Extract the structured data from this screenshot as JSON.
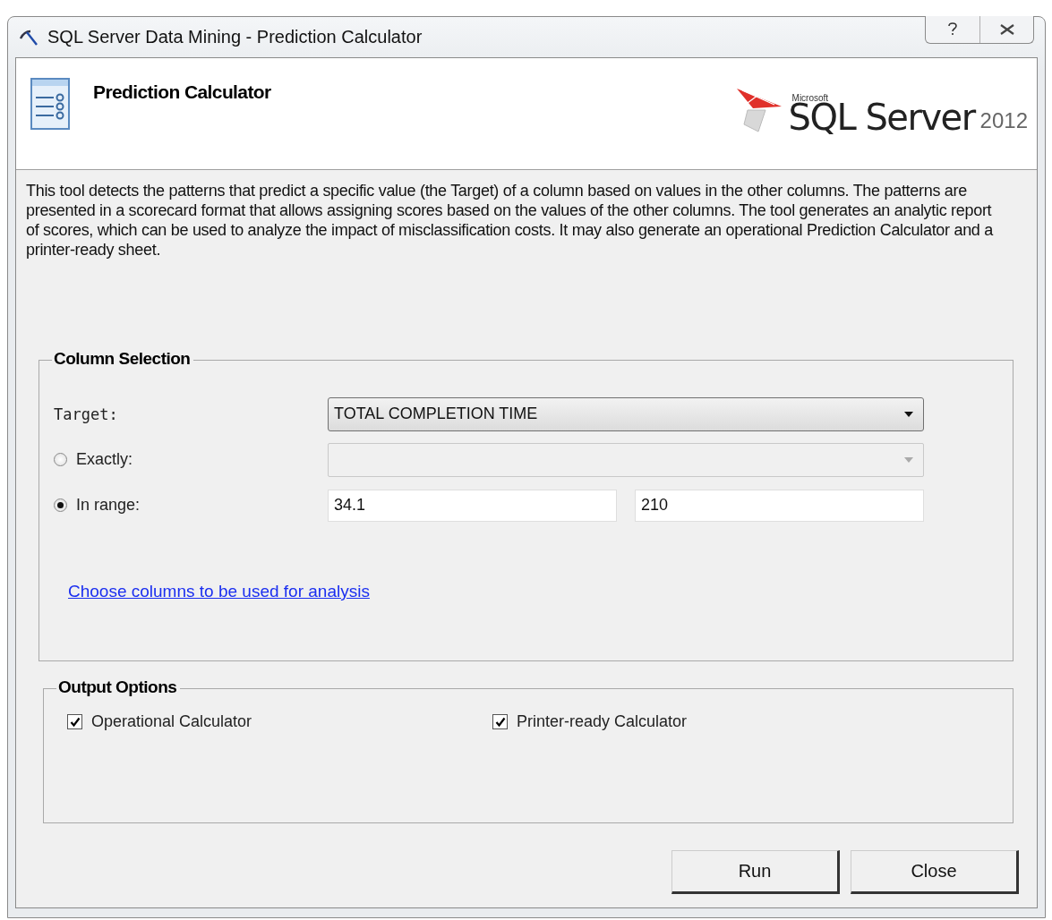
{
  "window": {
    "title": "SQL Server Data Mining - Prediction Calculator"
  },
  "header": {
    "title": "Prediction Calculator",
    "logo": {
      "brand": "Microsoft",
      "product": "SQL Server",
      "version": "2012"
    }
  },
  "description": "This tool detects the patterns that predict a specific value (the Target) of a column based on values in the other columns. The patterns are presented in a scorecard format that allows assigning scores based on the values of the other columns. The tool generates an analytic report of scores, which can be used to analyze the impact of misclassification costs. It may also generate an operational Prediction Calculator and a printer-ready sheet.",
  "column_selection": {
    "title": "Column Selection",
    "target_label": "Target:",
    "target_value": "TOTAL COMPLETION TIME",
    "options": [
      {
        "label": "Exactly:",
        "selected": false,
        "kind": "single",
        "disabled": true
      },
      {
        "label": "In range:",
        "selected": true,
        "kind": "range",
        "from": "34.1",
        "to": "210"
      }
    ],
    "link": "Choose columns to be used for analysis"
  },
  "output_options": {
    "title": "Output Options",
    "items": [
      {
        "label": "Operational Calculator",
        "checked": true
      },
      {
        "label": "Printer-ready Calculator",
        "checked": true
      }
    ]
  },
  "buttons": [
    "Run",
    "Close"
  ]
}
